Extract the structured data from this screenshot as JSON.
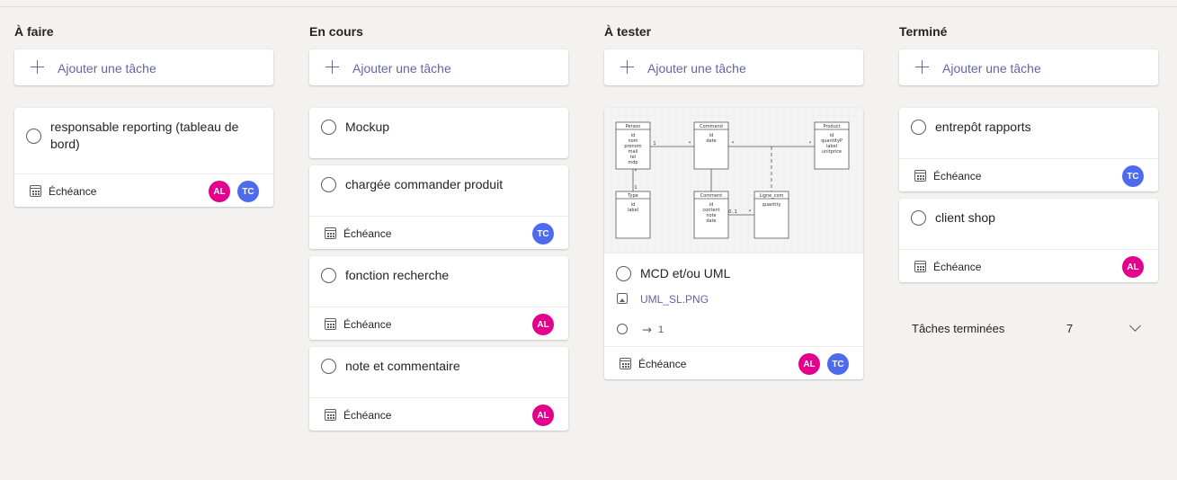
{
  "add_task_label": "Ajouter une tâche",
  "due_label": "Échéance",
  "colors": {
    "accent": "#6264a7",
    "avatar_al": "#e3008c",
    "avatar_tc": "#4f6bed"
  },
  "columns": [
    {
      "title": "À faire",
      "tasks": [
        {
          "title": "responsable reporting (tableau de bord)",
          "due": "Échéance",
          "assignees": [
            "AL",
            "TC"
          ]
        }
      ]
    },
    {
      "title": "En cours",
      "tasks": [
        {
          "title": "Mockup"
        },
        {
          "title": "chargée commander produit",
          "due": "Échéance",
          "assignees": [
            "TC"
          ]
        },
        {
          "title": "fonction recherche",
          "due": "Échéance",
          "assignees": [
            "AL"
          ]
        },
        {
          "title": "note et commentaire",
          "due": "Échéance",
          "assignees": [
            "AL"
          ]
        }
      ]
    },
    {
      "title": "À tester",
      "tasks": [
        {
          "title": "MCD et/ou UML",
          "attachment": "UML_SL.PNG",
          "attachment_count": "1",
          "due": "Échéance",
          "assignees": [
            "AL",
            "TC"
          ],
          "preview": {
            "entities": [
              {
                "name": "Person",
                "fields": [
                  "id",
                  "nom",
                  "prenom",
                  "mail",
                  "tel",
                  "mdp"
                ]
              },
              {
                "name": "Command",
                "fields": [
                  "id",
                  "date"
                ]
              },
              {
                "name": "Product",
                "fields": [
                  "id",
                  "quantityP",
                  "label",
                  "unitprice"
                ]
              },
              {
                "name": "Type",
                "fields": [
                  "id",
                  "label"
                ]
              },
              {
                "name": "Comment",
                "fields": [
                  "id",
                  "content",
                  "note",
                  "date"
                ]
              },
              {
                "name": "Ligne_com",
                "fields": [
                  "quantity"
                ]
              }
            ],
            "multiplicities": [
              "1",
              "*",
              "*",
              "*",
              "*",
              "1",
              "0..1",
              "*"
            ]
          }
        }
      ]
    },
    {
      "title": "Terminé",
      "tasks": [
        {
          "title": "entrepôt rapports",
          "due": "Échéance",
          "assignees": [
            "TC"
          ]
        },
        {
          "title": "client shop",
          "due": "Échéance",
          "assignees": [
            "AL"
          ]
        }
      ],
      "completed_label": "Tâches terminées",
      "completed_count": "7"
    }
  ]
}
